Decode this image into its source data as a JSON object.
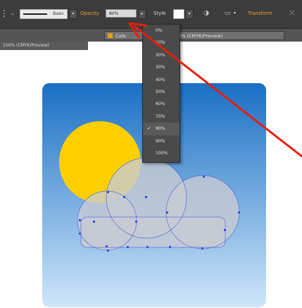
{
  "control_bar": {
    "stroke_label": "Basic",
    "opacity_label": "Opacity",
    "opacity_value": "80%",
    "style_label": "Style",
    "transform_label": "Transform"
  },
  "tabs": {
    "active_prefix": "Cafe",
    "active_suffix": "150% (CMYK/Preview)",
    "secondary": "150% (CMYK/Preview)"
  },
  "opacity_menu": {
    "options": [
      "0%",
      "10%",
      "20%",
      "30%",
      "40%",
      "50%",
      "60%",
      "70%",
      "80%",
      "90%",
      "100%"
    ],
    "selected_index": 8
  },
  "colors": {
    "sky_top": "#1a6fc4",
    "sky_bottom": "#cfe6fa",
    "sun": "#ffcf00",
    "cloud": "#c8cad3",
    "selection": "#3a4fd8",
    "arrow": "#e61e10"
  }
}
